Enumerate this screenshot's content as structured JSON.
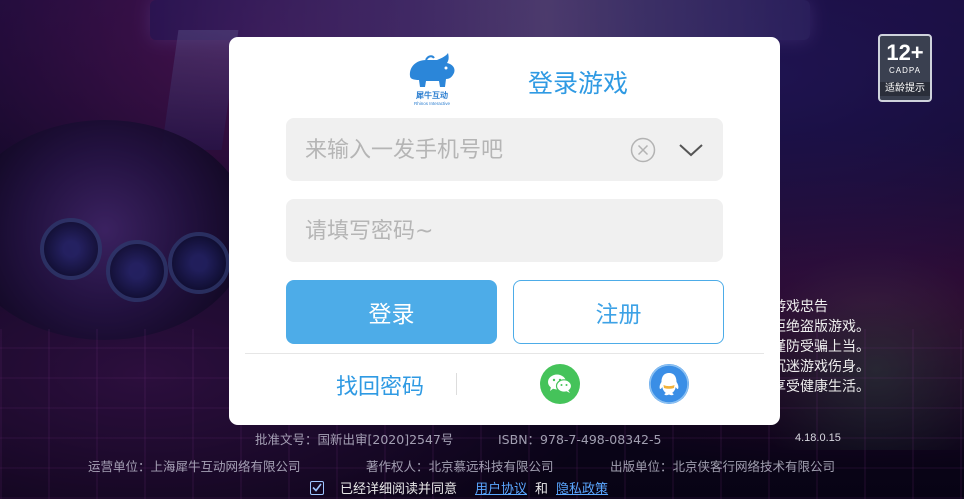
{
  "dialog": {
    "logo_brand": "犀牛互动",
    "logo_sub": "Rhinos Interactive",
    "title": "登录游戏",
    "phone_placeholder": "来输入一发手机号吧",
    "phone_value": "",
    "password_placeholder": "请填写密码~",
    "password_value": "",
    "login_label": "登录",
    "register_label": "注册",
    "forgot_label": "找回密码",
    "social": [
      "wechat-icon",
      "qq-icon"
    ],
    "colors": {
      "accent": "#4dace8",
      "title": "#2f9ae3",
      "wechat": "#45c35a",
      "qq": "#3a8ee6"
    }
  },
  "age_badge": {
    "rating": "12+",
    "org": "CADPA",
    "tip": "适龄提示"
  },
  "health_advice": {
    "title": "游戏忠告",
    "lines": [
      "拒绝盗版游戏。",
      "谨防受骗上当。",
      "沉迷游戏伤身。",
      "享受健康生活。"
    ]
  },
  "footer": {
    "approval": "批准文号：国新出审[2020]2547号",
    "isbn": "ISBN：978-7-498-08342-5",
    "version": "4.18.0.15",
    "operator": "运营单位：上海犀牛互动网络有限公司",
    "copyright": "著作权人：北京慕远科技有限公司",
    "publisher": "出版单位：北京侠客行网络技术有限公司",
    "agree_text": "已经详细阅读并同意",
    "agree_user": "用户协议",
    "agree_and": "和",
    "agree_privacy": "隐私政策"
  }
}
